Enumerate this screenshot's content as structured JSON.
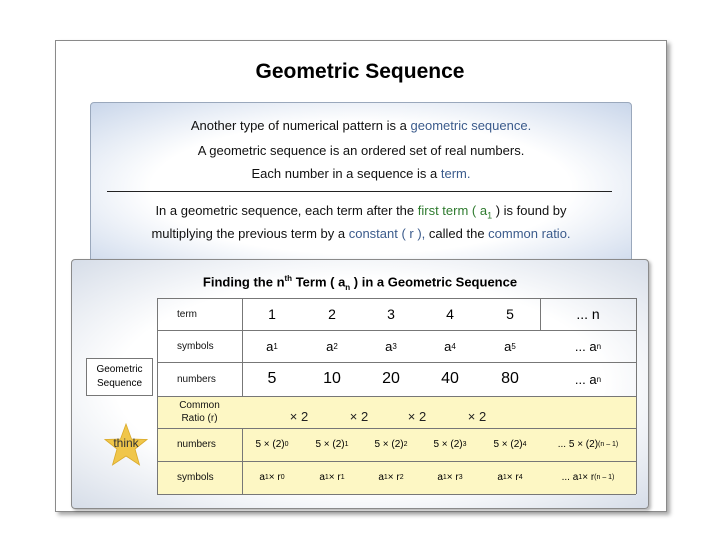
{
  "title": "Geometric Sequence",
  "intro": {
    "line1_pre": "Another type of numerical pattern is a ",
    "line1_term": "geometric sequence.",
    "line2": "A geometric sequence is an ordered set of real numbers.",
    "line3_pre": "Each number in a sequence is a ",
    "line3_term": "term.",
    "line4_pre": "In a geometric sequence, each term after the ",
    "line4_term": "first term ( a",
    "line4_sub": "1",
    "line4_post": " ) is found by",
    "line5_pre": "multiplying the previous term by a ",
    "line5_term1": "constant ( r ),",
    "line5_mid": " called the ",
    "line5_term2": "common ratio."
  },
  "table": {
    "title_pre": "Finding the n",
    "title_sup": "th",
    "title_mid": " Term ( a",
    "title_sub": "n",
    "title_post": " ) in a Geometric Sequence",
    "side_label": "Geometric\nSequence",
    "think_label": "think",
    "row_labels": {
      "term": "term",
      "symbols": "symbols",
      "numbers": "numbers",
      "ratio": "Common Ratio (r)",
      "numbers2": "numbers",
      "symbols2": "symbols"
    },
    "terms": [
      "1",
      "2",
      "3",
      "4",
      "5",
      "... n"
    ],
    "symbols": [
      {
        "base": "a",
        "sub": "1"
      },
      {
        "base": "a",
        "sub": "2"
      },
      {
        "base": "a",
        "sub": "3"
      },
      {
        "base": "a",
        "sub": "4"
      },
      {
        "base": "a",
        "sub": "5"
      },
      {
        "base": "... a",
        "sub": "n"
      }
    ],
    "numbers": [
      {
        "base": "5",
        "sub": ""
      },
      {
        "base": "10",
        "sub": ""
      },
      {
        "base": "20",
        "sub": ""
      },
      {
        "base": "40",
        "sub": ""
      },
      {
        "base": "80",
        "sub": ""
      },
      {
        "base": "... a",
        "sub": "n"
      }
    ],
    "ratio_marks": [
      "× 2",
      "× 2",
      "× 2",
      "× 2"
    ],
    "number_exprs": [
      {
        "base": "5 × (2)",
        "sup": "0"
      },
      {
        "base": "5 × (2)",
        "sup": "1"
      },
      {
        "base": "5 × (2)",
        "sup": "2"
      },
      {
        "base": "5 × (2)",
        "sup": "3"
      },
      {
        "base": "5 × (2)",
        "sup": "4"
      },
      {
        "base": "... 5 × (2)",
        "sup": "(n – 1)"
      }
    ],
    "symbol_exprs": [
      {
        "sup": "0"
      },
      {
        "sup": "1"
      },
      {
        "sup": "2"
      },
      {
        "sup": "3"
      },
      {
        "sup": "4"
      },
      {
        "sup": "(n – 1)"
      }
    ],
    "symbol_expr_a": "a",
    "symbol_expr_sub": "1",
    "symbol_expr_mid": " × r"
  },
  "colors": {
    "term_blue": "#3b5b8c",
    "term_green": "#2e7a2e",
    "band_yellow": "#fdf7c4",
    "star_gold": "#f0c64a"
  }
}
